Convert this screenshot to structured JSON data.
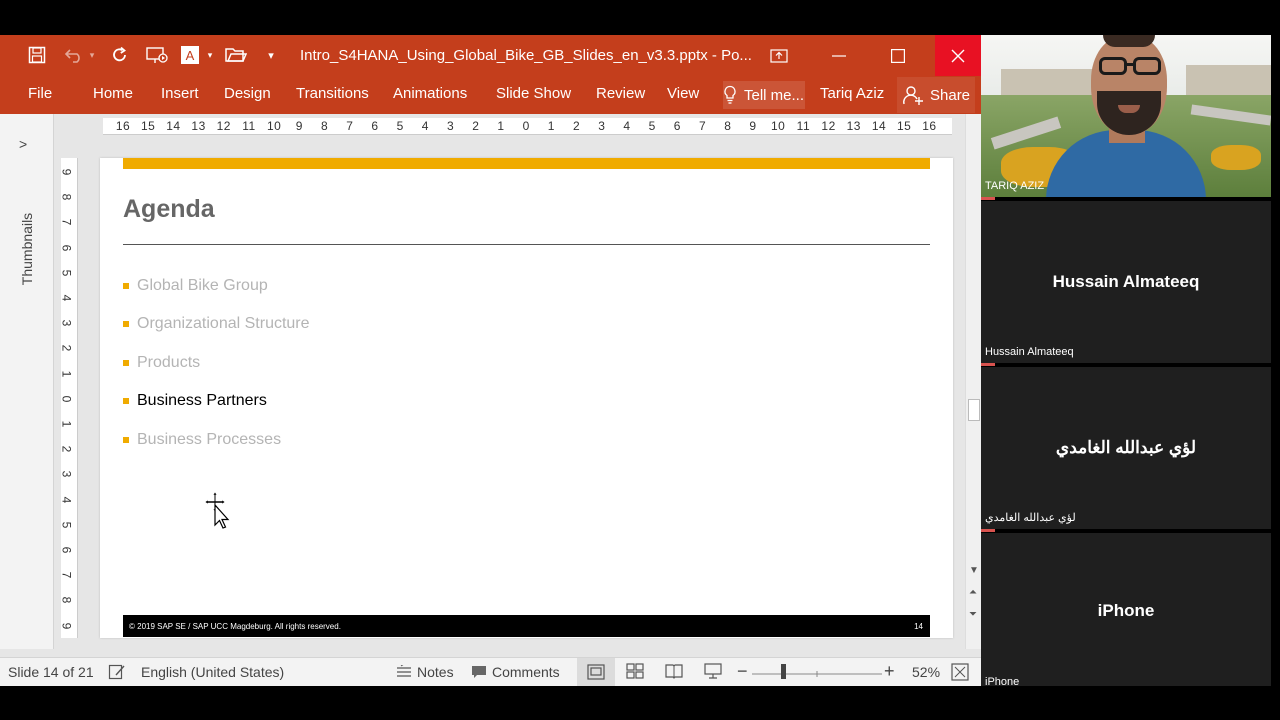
{
  "window": {
    "title": "Intro_S4HANA_Using_Global_Bike_GB_Slides_en_v3.3.pptx - Po...",
    "ribbon_tabs": [
      "File",
      "Home",
      "Insert",
      "Design",
      "Transitions",
      "Animations",
      "Slide Show",
      "Review",
      "View"
    ],
    "tell_me": "Tell me...",
    "user": "Tariq Aziz",
    "share": "Share",
    "accent_color": "#c43e1c"
  },
  "sidebar": {
    "thumbnails_label": "Thumbnails"
  },
  "ruler": {
    "horizontal": [
      "16",
      "15",
      "14",
      "13",
      "12",
      "11",
      "10",
      "9",
      "8",
      "7",
      "6",
      "5",
      "4",
      "3",
      "2",
      "1",
      "0",
      "1",
      "2",
      "3",
      "4",
      "5",
      "6",
      "7",
      "8",
      "9",
      "10",
      "11",
      "12",
      "13",
      "14",
      "15",
      "16"
    ],
    "vertical": [
      "9",
      "8",
      "7",
      "6",
      "5",
      "4",
      "3",
      "2",
      "1",
      "0",
      "1",
      "2",
      "3",
      "4",
      "5",
      "6",
      "7",
      "8",
      "9"
    ]
  },
  "slide": {
    "title": "Agenda",
    "bullets": [
      {
        "text": "Global Bike Group",
        "active": false
      },
      {
        "text": "Organizational Structure",
        "active": false
      },
      {
        "text": "Products",
        "active": false
      },
      {
        "text": "Business Partners",
        "active": true
      },
      {
        "text": "Business Processes",
        "active": false
      }
    ],
    "footer_copyright": "© 2019 SAP SE / SAP UCC Magdeburg. All rights reserved.",
    "footer_page": "14",
    "accent_color": "#f0ab00"
  },
  "status": {
    "slide_counter": "Slide 14 of 21",
    "language": "English (United States)",
    "notes": "Notes",
    "comments": "Comments",
    "zoom": "52%",
    "zoom_value_percent": 52
  },
  "meeting": {
    "participants": [
      {
        "caption": "TARIQ AZIZ",
        "display": "",
        "video": true
      },
      {
        "caption": "Hussain Almateeq",
        "display": "Hussain Almateeq",
        "video": false
      },
      {
        "caption": "لؤي عبدالله الغامدي",
        "display": "لؤي عبدالله الغامدي",
        "video": false
      },
      {
        "caption": "iPhone",
        "display": "iPhone",
        "video": false
      }
    ]
  }
}
